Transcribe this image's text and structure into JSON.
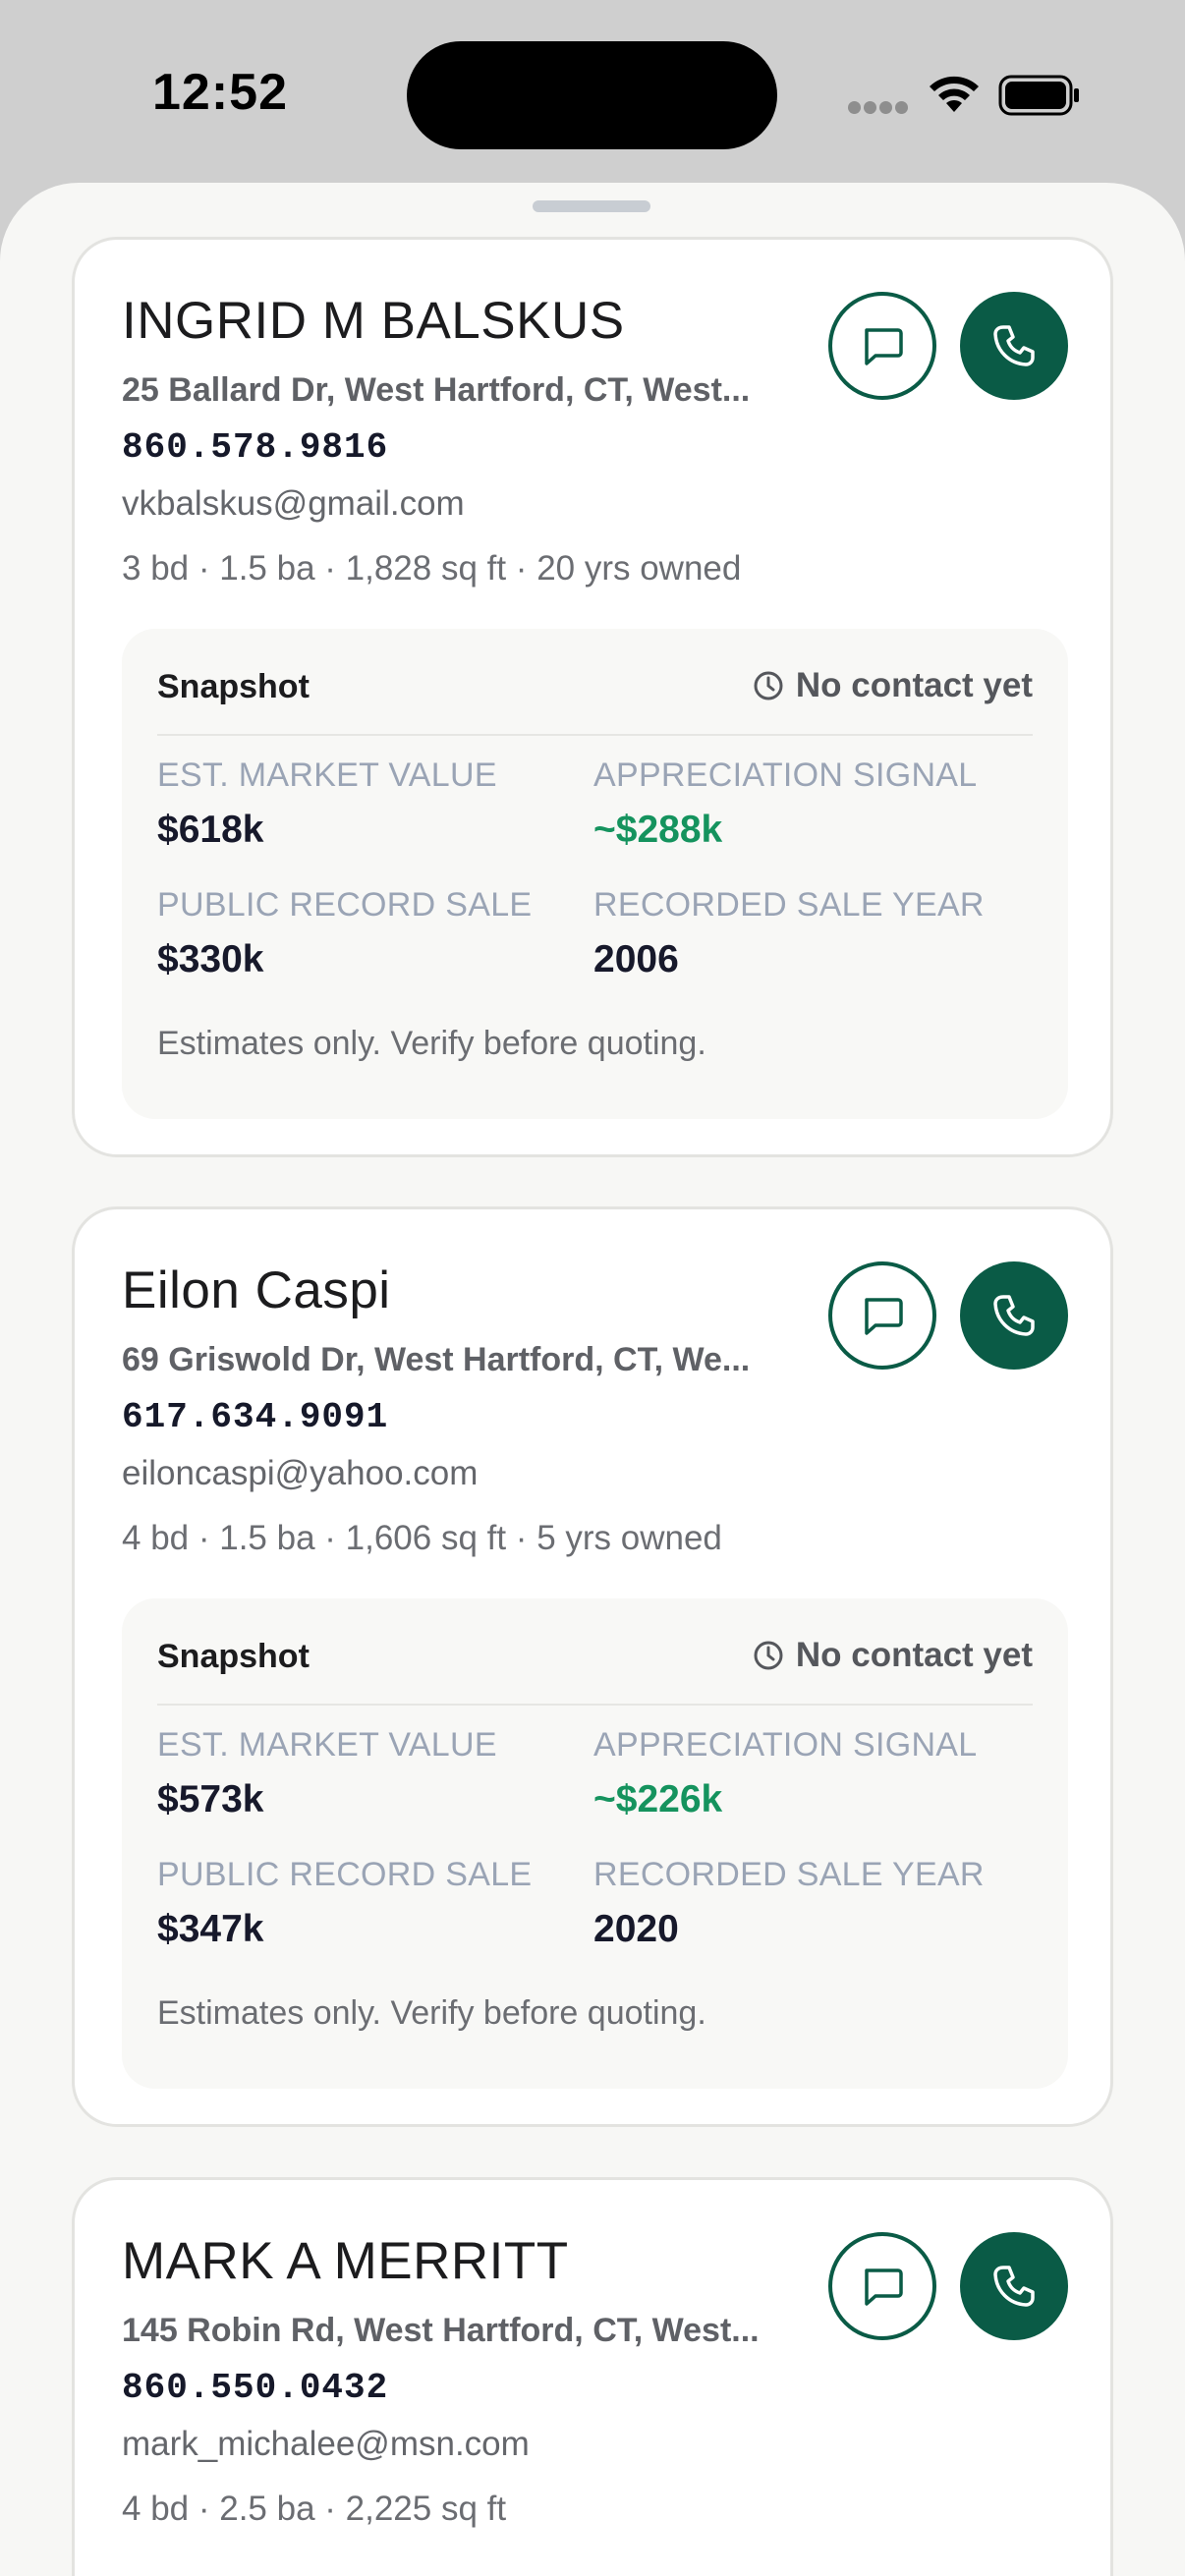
{
  "status_bar": {
    "time": "12:52"
  },
  "cards": [
    {
      "name": "INGRID M BALSKUS",
      "address": "25 Ballard Dr, West Hartford, CT, West...",
      "phone": "860.578.9816",
      "email": "vkbalskus@gmail.com",
      "meta": "3 bd · 1.5 ba · 1,828 sq ft · 20 yrs owned",
      "snapshot": {
        "title": "Snapshot",
        "status": "No contact yet",
        "est_market_value_label": "EST. MARKET VALUE",
        "est_market_value": "$618k",
        "appreciation_label": "APPRECIATION SIGNAL",
        "appreciation": "~$288k",
        "public_record_sale_label": "PUBLIC RECORD SALE",
        "public_record_sale": "$330k",
        "recorded_sale_year_label": "RECORDED SALE YEAR",
        "recorded_sale_year": "2006",
        "note": "Estimates only. Verify before quoting."
      }
    },
    {
      "name": "Eilon Caspi",
      "address": "69 Griswold Dr, West Hartford, CT, We...",
      "phone": "617.634.9091",
      "email": "eiloncaspi@yahoo.com",
      "meta": "4 bd · 1.5 ba · 1,606 sq ft · 5 yrs owned",
      "snapshot": {
        "title": "Snapshot",
        "status": "No contact yet",
        "est_market_value_label": "EST. MARKET VALUE",
        "est_market_value": "$573k",
        "appreciation_label": "APPRECIATION SIGNAL",
        "appreciation": "~$226k",
        "public_record_sale_label": "PUBLIC RECORD SALE",
        "public_record_sale": "$347k",
        "recorded_sale_year_label": "RECORDED SALE YEAR",
        "recorded_sale_year": "2020",
        "note": "Estimates only. Verify before quoting."
      }
    },
    {
      "name": "MARK A MERRITT",
      "address": "145 Robin Rd, West Hartford, CT, West...",
      "phone": "860.550.0432",
      "email": "mark_michalee@msn.com",
      "meta": "4 bd · 2.5 ba · 2,225 sq ft"
    }
  ],
  "colors": {
    "brand_green": "#0a5b46",
    "appreciation_green": "#15935e",
    "metric_label": "#9aa4b5"
  },
  "icons": {
    "message": "message-icon",
    "call": "phone-icon",
    "status": "clock-icon"
  }
}
